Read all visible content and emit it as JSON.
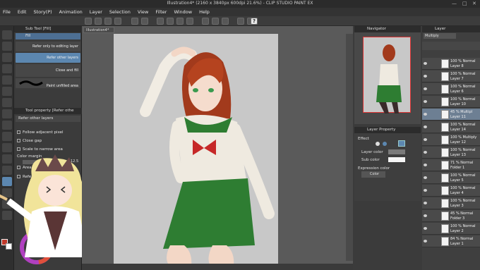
{
  "window": {
    "title": "Illustration4* (2160 x 3840px 600dpi 21.6%) - CLIP STUDIO PAINT EX"
  },
  "menu": [
    "File",
    "Edit",
    "Story(P)",
    "Animation",
    "Layer",
    "Selection",
    "View",
    "Filter",
    "Window",
    "Help"
  ],
  "document_tab": "Illustration4*",
  "subtool": {
    "header": "Sub Tool [Fill]",
    "tab": "Fill",
    "items": [
      "Refer only to editing layer",
      "Refer other layers",
      "Close and fill",
      "Paint unfilled area"
    ],
    "property_header": "Tool property [Refer othe",
    "property_tab": "Refer other layers",
    "options": [
      "Follow adjacent pixel",
      "Close gap",
      "Scale to narrow area",
      "Color margin",
      "Area scaling",
      "Refer multi..."
    ],
    "color_margin_value": "12.5"
  },
  "navigator": {
    "header": "Navigator"
  },
  "layer_property": {
    "header": "Layer Property",
    "effect_label": "Effect",
    "layer_color_label": "Layer color",
    "sub_color_label": "Sub color",
    "expression_color_label": "Expression color",
    "expression_color_value": "Color"
  },
  "layers": {
    "blend_mode": "Multiply",
    "header": "Layer",
    "rows": [
      {
        "l1": "100 % Normal",
        "l2": "Layer 8",
        "selected": false
      },
      {
        "l1": "100 % Normal",
        "l2": "Layer 7",
        "selected": false
      },
      {
        "l1": "100 % Normal",
        "l2": "Layer 6",
        "selected": false
      },
      {
        "l1": "100 % Normal",
        "l2": "Layer 10",
        "selected": false
      },
      {
        "l1": "45 % Multipl",
        "l2": "Layer 11",
        "selected": true
      },
      {
        "l1": "100 % Normal",
        "l2": "Layer 14",
        "selected": false
      },
      {
        "l1": "100 % Multiply",
        "l2": "Layer 12",
        "selected": false
      },
      {
        "l1": "100 % Normal",
        "l2": "Layer 13",
        "selected": false
      },
      {
        "l1": "71 % Normal",
        "l2": "Folder 1",
        "selected": false
      },
      {
        "l1": "100 % Normal",
        "l2": "Layer 5",
        "selected": false
      },
      {
        "l1": "100 % Normal",
        "l2": "Layer 4",
        "selected": false
      },
      {
        "l1": "100 % Normal",
        "l2": "Layer 3",
        "selected": false
      },
      {
        "l1": "45 % Normal",
        "l2": "Folder 3",
        "selected": false
      },
      {
        "l1": "100 % Normal",
        "l2": "Layer 2",
        "selected": false
      },
      {
        "l1": "84 % Normal",
        "l2": "Layer 1",
        "selected": false
      }
    ]
  },
  "colors": {
    "accent": "#5c87b0",
    "selected_layer": "#6d7f93",
    "paper": "#c8c8c8"
  }
}
